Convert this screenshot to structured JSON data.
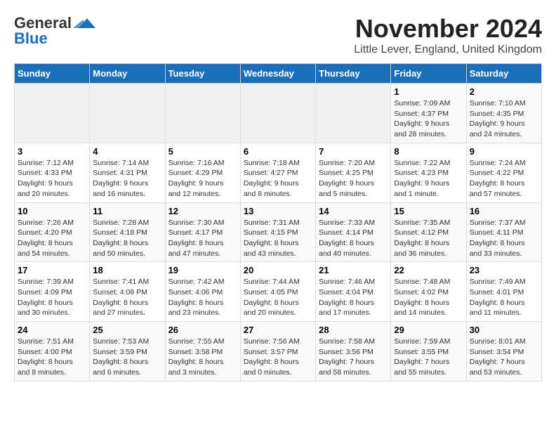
{
  "header": {
    "logo_line1": "General",
    "logo_line2": "Blue",
    "title": "November 2024",
    "subtitle": "Little Lever, England, United Kingdom"
  },
  "days_of_week": [
    "Sunday",
    "Monday",
    "Tuesday",
    "Wednesday",
    "Thursday",
    "Friday",
    "Saturday"
  ],
  "weeks": [
    [
      {
        "day": "",
        "info": ""
      },
      {
        "day": "",
        "info": ""
      },
      {
        "day": "",
        "info": ""
      },
      {
        "day": "",
        "info": ""
      },
      {
        "day": "",
        "info": ""
      },
      {
        "day": "1",
        "info": "Sunrise: 7:09 AM\nSunset: 4:37 PM\nDaylight: 9 hours\nand 28 minutes."
      },
      {
        "day": "2",
        "info": "Sunrise: 7:10 AM\nSunset: 4:35 PM\nDaylight: 9 hours\nand 24 minutes."
      }
    ],
    [
      {
        "day": "3",
        "info": "Sunrise: 7:12 AM\nSunset: 4:33 PM\nDaylight: 9 hours\nand 20 minutes."
      },
      {
        "day": "4",
        "info": "Sunrise: 7:14 AM\nSunset: 4:31 PM\nDaylight: 9 hours\nand 16 minutes."
      },
      {
        "day": "5",
        "info": "Sunrise: 7:16 AM\nSunset: 4:29 PM\nDaylight: 9 hours\nand 12 minutes."
      },
      {
        "day": "6",
        "info": "Sunrise: 7:18 AM\nSunset: 4:27 PM\nDaylight: 9 hours\nand 8 minutes."
      },
      {
        "day": "7",
        "info": "Sunrise: 7:20 AM\nSunset: 4:25 PM\nDaylight: 9 hours\nand 5 minutes."
      },
      {
        "day": "8",
        "info": "Sunrise: 7:22 AM\nSunset: 4:23 PM\nDaylight: 9 hours\nand 1 minute."
      },
      {
        "day": "9",
        "info": "Sunrise: 7:24 AM\nSunset: 4:22 PM\nDaylight: 8 hours\nand 57 minutes."
      }
    ],
    [
      {
        "day": "10",
        "info": "Sunrise: 7:26 AM\nSunset: 4:20 PM\nDaylight: 8 hours\nand 54 minutes."
      },
      {
        "day": "11",
        "info": "Sunrise: 7:28 AM\nSunset: 4:18 PM\nDaylight: 8 hours\nand 50 minutes."
      },
      {
        "day": "12",
        "info": "Sunrise: 7:30 AM\nSunset: 4:17 PM\nDaylight: 8 hours\nand 47 minutes."
      },
      {
        "day": "13",
        "info": "Sunrise: 7:31 AM\nSunset: 4:15 PM\nDaylight: 8 hours\nand 43 minutes."
      },
      {
        "day": "14",
        "info": "Sunrise: 7:33 AM\nSunset: 4:14 PM\nDaylight: 8 hours\nand 40 minutes."
      },
      {
        "day": "15",
        "info": "Sunrise: 7:35 AM\nSunset: 4:12 PM\nDaylight: 8 hours\nand 36 minutes."
      },
      {
        "day": "16",
        "info": "Sunrise: 7:37 AM\nSunset: 4:11 PM\nDaylight: 8 hours\nand 33 minutes."
      }
    ],
    [
      {
        "day": "17",
        "info": "Sunrise: 7:39 AM\nSunset: 4:09 PM\nDaylight: 8 hours\nand 30 minutes."
      },
      {
        "day": "18",
        "info": "Sunrise: 7:41 AM\nSunset: 4:08 PM\nDaylight: 8 hours\nand 27 minutes."
      },
      {
        "day": "19",
        "info": "Sunrise: 7:42 AM\nSunset: 4:06 PM\nDaylight: 8 hours\nand 23 minutes."
      },
      {
        "day": "20",
        "info": "Sunrise: 7:44 AM\nSunset: 4:05 PM\nDaylight: 8 hours\nand 20 minutes."
      },
      {
        "day": "21",
        "info": "Sunrise: 7:46 AM\nSunset: 4:04 PM\nDaylight: 8 hours\nand 17 minutes."
      },
      {
        "day": "22",
        "info": "Sunrise: 7:48 AM\nSunset: 4:02 PM\nDaylight: 8 hours\nand 14 minutes."
      },
      {
        "day": "23",
        "info": "Sunrise: 7:49 AM\nSunset: 4:01 PM\nDaylight: 8 hours\nand 11 minutes."
      }
    ],
    [
      {
        "day": "24",
        "info": "Sunrise: 7:51 AM\nSunset: 4:00 PM\nDaylight: 8 hours\nand 8 minutes."
      },
      {
        "day": "25",
        "info": "Sunrise: 7:53 AM\nSunset: 3:59 PM\nDaylight: 8 hours\nand 6 minutes."
      },
      {
        "day": "26",
        "info": "Sunrise: 7:55 AM\nSunset: 3:58 PM\nDaylight: 8 hours\nand 3 minutes."
      },
      {
        "day": "27",
        "info": "Sunrise: 7:56 AM\nSunset: 3:57 PM\nDaylight: 8 hours\nand 0 minutes."
      },
      {
        "day": "28",
        "info": "Sunrise: 7:58 AM\nSunset: 3:56 PM\nDaylight: 7 hours\nand 58 minutes."
      },
      {
        "day": "29",
        "info": "Sunrise: 7:59 AM\nSunset: 3:55 PM\nDaylight: 7 hours\nand 55 minutes."
      },
      {
        "day": "30",
        "info": "Sunrise: 8:01 AM\nSunset: 3:54 PM\nDaylight: 7 hours\nand 53 minutes."
      }
    ]
  ]
}
